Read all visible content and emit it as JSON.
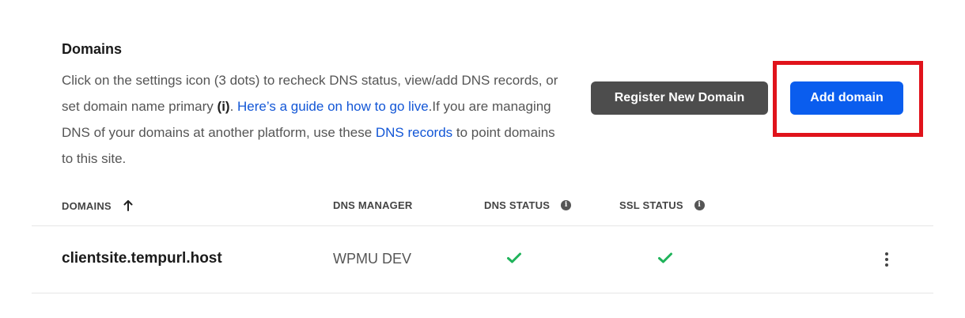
{
  "section": {
    "title": "Domains",
    "description": {
      "part1": "Click on the settings icon (3 dots) to recheck DNS status, view/add DNS records, or set domain name primary ",
      "info_marker": "(i)",
      "part2": ". ",
      "guide_link": "Here’s a guide on how to go live",
      "part3": ".If you are managing DNS of your domains at another platform, use these ",
      "dns_link": "DNS records",
      "part4": " to point domains to this site."
    }
  },
  "actions": {
    "register_label": "Register New Domain",
    "add_label": "Add domain"
  },
  "table": {
    "columns": {
      "domains": "DOMAINS",
      "dns_manager": "DNS MANAGER",
      "dns_status": "DNS STATUS",
      "ssl_status": "SSL STATUS"
    },
    "sort_icon": "arrow-up-icon",
    "info_icon": "info-icon",
    "rows": [
      {
        "domain": "clientsite.tempurl.host",
        "dns_manager": "WPMU DEV",
        "dns_status_icon": "check-icon",
        "ssl_status_icon": "check-icon",
        "menu_icon": "kebab-menu-icon"
      }
    ]
  },
  "colors": {
    "primary": "#0a5dee",
    "secondary": "#4d4d4d",
    "link": "#1256d6",
    "success": "#1fb35a",
    "highlight": "#e0131b"
  }
}
